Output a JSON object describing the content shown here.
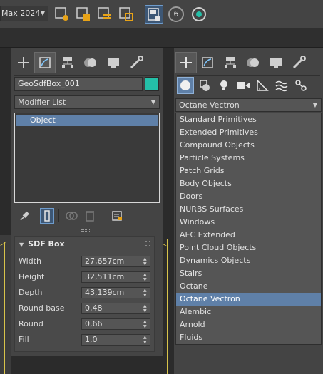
{
  "toolbar": {
    "app_dropdown": "Max 2024",
    "render_count": "6"
  },
  "left_panel": {
    "tabs": [
      "create-tab",
      "modify-tab",
      "hierarchy-tab",
      "motion-tab",
      "display-tab",
      "utilities-tab"
    ],
    "object_name": "GeoSdfBox_001",
    "object_color": "#24c0a8",
    "modifier_list": "Modifier List",
    "stack_item": "Object",
    "rollout": {
      "title": "SDF Box",
      "properties": [
        {
          "label": "Width",
          "value": "27,657cm"
        },
        {
          "label": "Height",
          "value": "32,511cm"
        },
        {
          "label": "Depth",
          "value": "43,139cm"
        },
        {
          "label": "Round base",
          "value": "0,48"
        },
        {
          "label": "Round",
          "value": "0,66"
        },
        {
          "label": "Fill",
          "value": "1,0"
        }
      ]
    }
  },
  "right_panel": {
    "category_dropdown": "Octane Vectron",
    "categories": [
      "Standard Primitives",
      "Extended Primitives",
      "Compound Objects",
      "Particle Systems",
      "Patch Grids",
      "Body Objects",
      "Doors",
      "NURBS Surfaces",
      "Windows",
      "AEC Extended",
      "Point Cloud Objects",
      "Dynamics Objects",
      "Stairs",
      "Octane",
      "Octane Vectron",
      "Alembic",
      "Arnold",
      "Fluids"
    ],
    "selected_category": "Octane Vectron"
  },
  "colors": {
    "selection": "#5f80a8",
    "accent_active": "#3d5775",
    "object_color": "#24c0a8"
  }
}
